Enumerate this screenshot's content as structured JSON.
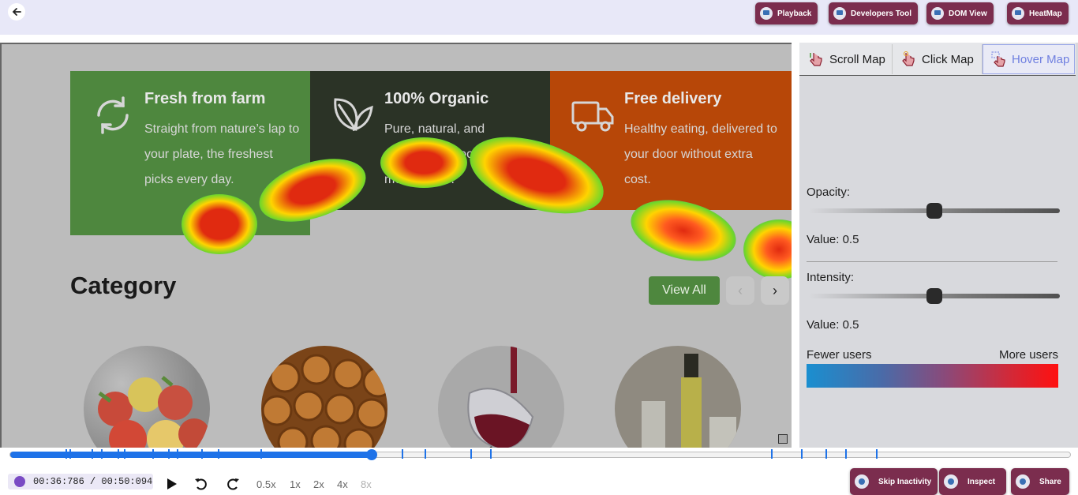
{
  "header": {
    "back_icon": "arrow-left-icon",
    "buttons": [
      {
        "label": "Playback",
        "icon": "playback-icon"
      },
      {
        "label": "Developers Tool",
        "icon": "developers-tool-icon"
      },
      {
        "label": "DOM View",
        "icon": "dom-view-icon"
      },
      {
        "label": "HeatMap",
        "icon": "heatmap-icon"
      }
    ]
  },
  "page": {
    "features": [
      {
        "title": "Fresh from farm",
        "description": "Straight from nature’s lap to your plate, the freshest picks every day.",
        "icon": "refresh-icon",
        "color": "#4e873e"
      },
      {
        "title": "100% Organic",
        "description": "Pure, natural, and untouched—food as it’s meant to be.",
        "icon": "leaf-icon",
        "color": "#2b3326"
      },
      {
        "title": "Free delivery",
        "description": "Healthy eating, delivered to your door without extra cost.",
        "icon": "truck-icon",
        "color": "#b74708"
      }
    ],
    "category_title": "Category",
    "view_all_label": "View All",
    "prev_icon": "chevron-left-icon",
    "next_icon": "chevron-right-icon",
    "category_images": [
      "apples-image",
      "cinnamon-rolls-image",
      "wine-glass-image",
      "oil-bottles-image"
    ]
  },
  "panel": {
    "tabs": [
      {
        "label": "Scroll Map",
        "icon": "scroll-pointer-icon",
        "active": false
      },
      {
        "label": "Click Map",
        "icon": "click-pointer-icon",
        "active": false
      },
      {
        "label": "Hover Map",
        "icon": "hover-pointer-icon",
        "active": true
      }
    ],
    "opacity": {
      "label": "Opacity:",
      "value": 0.5,
      "value_text": "Value: 0.5"
    },
    "intensity": {
      "label": "Intensity:",
      "value": 0.5,
      "value_text": "Value: 0.5"
    },
    "legend": {
      "low": "Fewer users",
      "high": "More users",
      "low_color": "#1a8fd0",
      "high_color": "#ff1010"
    }
  },
  "player": {
    "progress": 0.341,
    "time": "00:36:786 / 00:50:094",
    "speeds": [
      "0.5x",
      "1x",
      "2x",
      "4x",
      "8x"
    ],
    "speed_disabled": "8x",
    "controls": [
      "play-icon",
      "rewind-icon",
      "forward-icon"
    ],
    "event_markers": [
      0.052,
      0.056,
      0.077,
      0.086,
      0.101,
      0.107,
      0.134,
      0.149,
      0.157,
      0.18,
      0.196,
      0.236,
      0.369,
      0.391,
      0.434,
      0.453,
      0.718,
      0.746,
      0.769,
      0.788,
      0.817
    ],
    "buttons": [
      {
        "label": "Skip Inactivity",
        "icon": "skip-icon"
      },
      {
        "label": "Inspect",
        "icon": "inspect-icon"
      },
      {
        "label": "Share",
        "icon": "share-icon"
      }
    ],
    "accent_color": "#1e72e8",
    "button_color": "#7b2d4e"
  }
}
